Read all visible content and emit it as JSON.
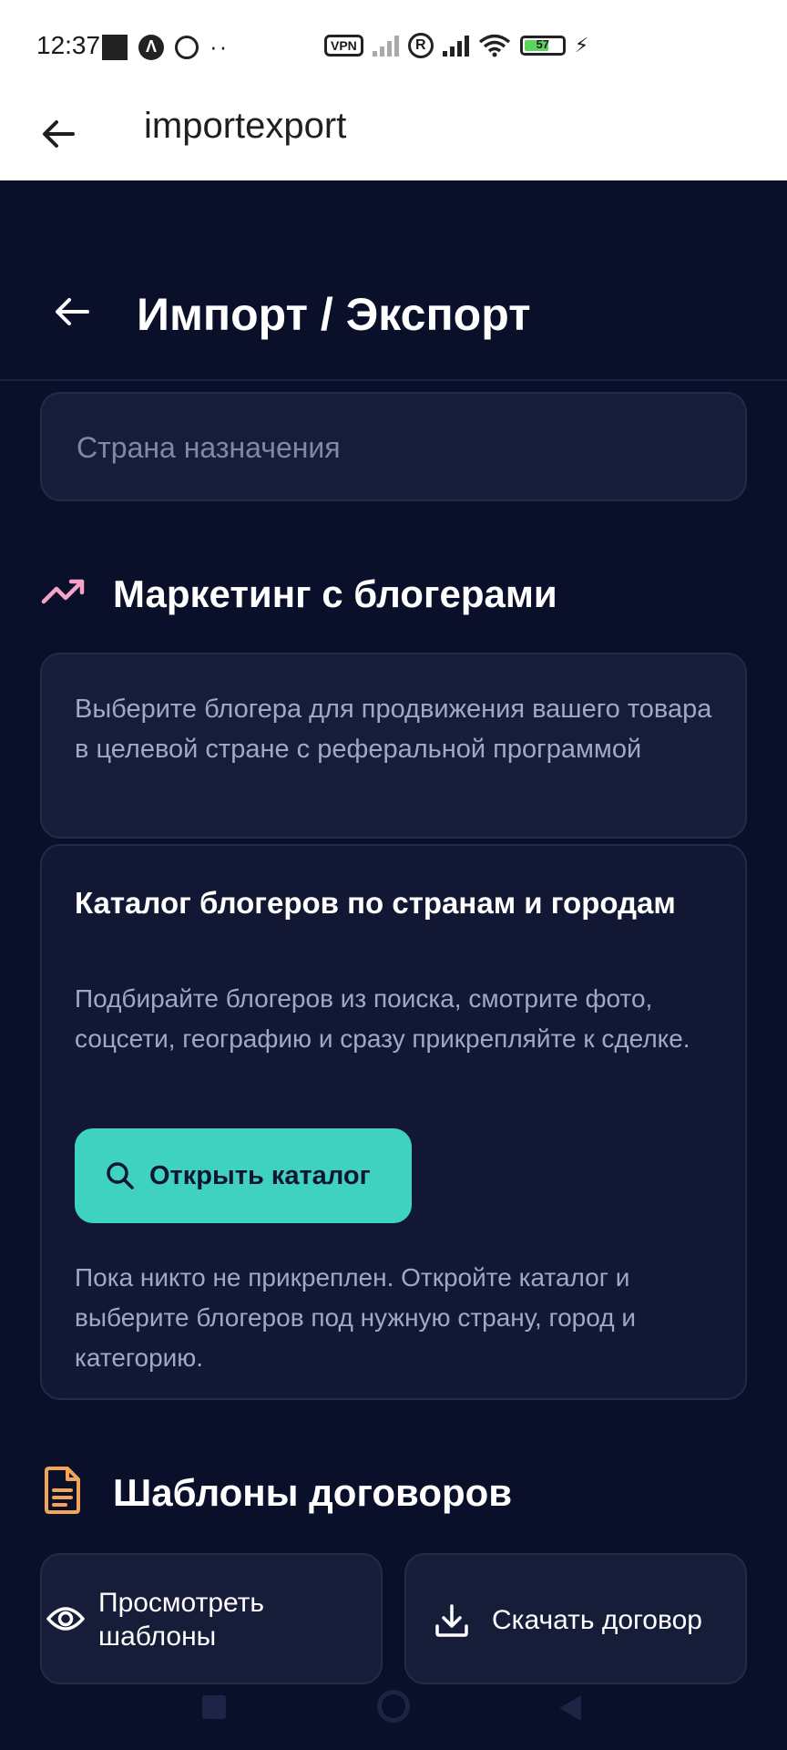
{
  "status_bar": {
    "time": "12:37",
    "battery_level": "57",
    "vpn_label": "VPN",
    "r_badge": "R"
  },
  "app_bar": {
    "title": "importexport"
  },
  "page": {
    "title": "Импорт / Экспорт"
  },
  "destination": {
    "placeholder": "Страна назначения",
    "value": ""
  },
  "marketing": {
    "title": "Маркетинг с блогерами",
    "icon": "trending-up-icon",
    "icon_color": "#f5a3c7",
    "description": "Выберите блогера для продвижения вашего товара в целевой стране с реферальной программой",
    "catalog": {
      "title": "Каталог блогеров по странам и городам",
      "description": "Подбирайте блогеров из поиска, смотрите фото, соцсети, географию и сразу прикрепляйте к сделке.",
      "button_label": "Открыть каталог",
      "button_color": "#3fd2c1",
      "note": "Пока никто не прикреплен. Откройте каталог и выберите блогеров под нужную страну, город и категорию."
    }
  },
  "templates": {
    "title": "Шаблоны договоров",
    "icon": "document-icon",
    "icon_color": "#f2a556",
    "view_label": "Просмотреть шаблоны",
    "download_label": "Скачать договор"
  },
  "colors": {
    "background": "#0a0f2a",
    "card": "#161d39",
    "accent": "#3fd2c1"
  }
}
